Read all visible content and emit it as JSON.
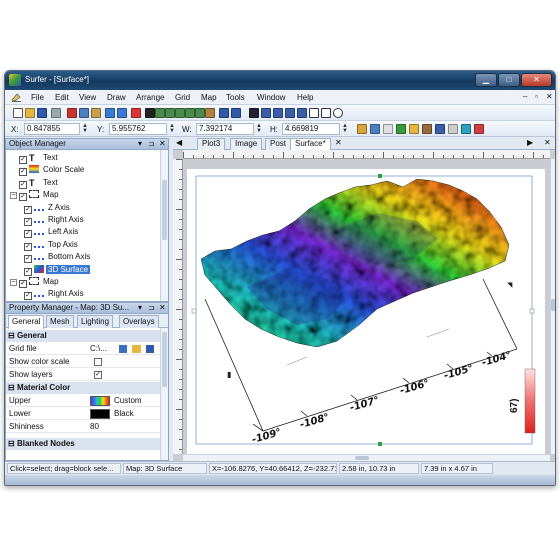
{
  "window": {
    "title": "Surfer - [Surface*]"
  },
  "menu": [
    "File",
    "Edit",
    "View",
    "Draw",
    "Arrange",
    "Grid",
    "Map",
    "Tools",
    "Window",
    "Help"
  ],
  "coords": {
    "x_label": "X:",
    "x_value": "0.847855",
    "y_label": "Y:",
    "y_value": "5.955762",
    "w_label": "W:",
    "w_value": "7.392174",
    "h_label": "H:",
    "h_value": "4.669819"
  },
  "object_manager": {
    "title": "Object Manager",
    "items": [
      {
        "label": "Text",
        "depth": 0,
        "expander": "",
        "checked": true,
        "icon": "text"
      },
      {
        "label": "Color Scale",
        "depth": 0,
        "expander": "",
        "checked": true,
        "icon": "colorscale"
      },
      {
        "label": "Text",
        "depth": 0,
        "expander": "",
        "checked": true,
        "icon": "text"
      },
      {
        "label": "Map",
        "depth": 0,
        "expander": "−",
        "checked": true,
        "icon": "map"
      },
      {
        "label": "Z Axis",
        "depth": 1,
        "expander": "",
        "checked": true,
        "icon": "axis"
      },
      {
        "label": "Right Axis",
        "depth": 1,
        "expander": "",
        "checked": true,
        "icon": "axis"
      },
      {
        "label": "Left Axis",
        "depth": 1,
        "expander": "",
        "checked": true,
        "icon": "axis"
      },
      {
        "label": "Top Axis",
        "depth": 1,
        "expander": "",
        "checked": true,
        "icon": "axis"
      },
      {
        "label": "Bottom Axis",
        "depth": 1,
        "expander": "",
        "checked": true,
        "icon": "axis"
      },
      {
        "label": "3D Surface",
        "depth": 1,
        "expander": "",
        "checked": true,
        "icon": "surface",
        "selected": true
      },
      {
        "label": "Map",
        "depth": 0,
        "expander": "−",
        "checked": true,
        "icon": "map"
      },
      {
        "label": "Right Axis",
        "depth": 1,
        "expander": "",
        "checked": true,
        "icon": "axis"
      }
    ]
  },
  "property_manager": {
    "title": "Property Manager - Map: 3D Su...",
    "tabs": [
      "General",
      "Mesh",
      "Lighting",
      "Overlays"
    ],
    "sections": {
      "general": "General",
      "material": "Material Color",
      "blanked": "Blanked Nodes"
    },
    "rows": {
      "grid_file": {
        "key": "Grid file",
        "value": "C:\\..."
      },
      "show_color_scale": {
        "key": "Show color scale",
        "checked": false
      },
      "show_layers": {
        "key": "Show layers",
        "checked": true
      },
      "upper": {
        "key": "Upper",
        "value": "Custom"
      },
      "lower": {
        "key": "Lower",
        "value": "Black"
      },
      "shininess": {
        "key": "Shininess",
        "value": "80"
      }
    }
  },
  "doc_tabs": [
    "Plot3",
    "Image",
    "Post",
    "Surface*"
  ],
  "plot": {
    "x_ticks": [
      "-109°",
      "-108°",
      "-107°",
      "-106°",
      "-105°",
      "-104°"
    ],
    "scale_label": "67)"
  },
  "status": {
    "hint": "Click=select; drag=block sele...",
    "object": "Map: 3D Surface",
    "cursor": "X=-106.8276, Y=40.66412, Z=-232.71...",
    "size": "2.58 in, 10.73 in",
    "page": "7.39 in x 4.67 in"
  },
  "colors": {
    "title_bar": "#1d4a73",
    "selection": "#3a78d6",
    "surface_high": "#e0201a",
    "surface_low": "#7a2bd6"
  }
}
